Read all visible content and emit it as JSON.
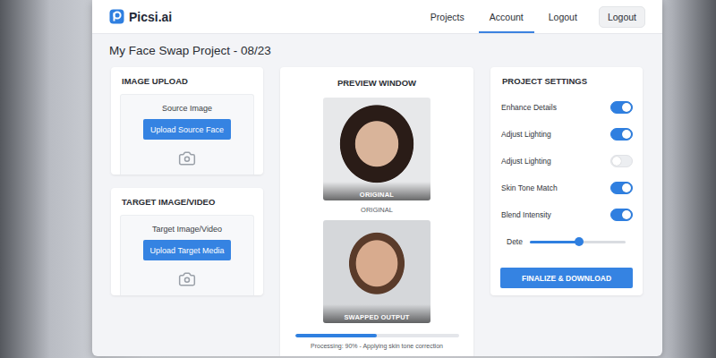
{
  "app": {
    "logo": "Picsi.ai"
  },
  "nav": [
    {
      "label": "Projects",
      "selected": false
    },
    {
      "label": "Account",
      "selected": true
    },
    {
      "label": "Logout",
      "selected": false
    }
  ],
  "nav_button": "Logout",
  "project_title": "My Face Swap Project - 08/23",
  "upload_cards": [
    {
      "title": "IMAGE UPLOAD",
      "label": "Source Image",
      "button": "Upload Source Face"
    },
    {
      "title": "TARGET IMAGE/VIDEO",
      "label": "Target Image/Video",
      "button": "Upload Target Media"
    }
  ],
  "preview": {
    "title": "PREVIEW WINDOW",
    "images": [
      {
        "overlay": "ORIGINAL",
        "caption": "ORIGINAL"
      },
      {
        "overlay": "SWAPPED OUTPUT",
        "caption": ""
      }
    ],
    "progress": {
      "level": 0.5,
      "text": "Processing: 90% - Applying skin tone correction"
    }
  },
  "settings": {
    "title": "PROJECT SETTINGS",
    "items": [
      {
        "kind": "toggle",
        "label": "Enhance Details",
        "on": true
      },
      {
        "kind": "toggle",
        "label": "Adjust Lighting",
        "on": true
      },
      {
        "kind": "toggle",
        "label": "Adjust Lighting",
        "on": false
      },
      {
        "kind": "toggle",
        "label": "Skin Tone Match",
        "on": true
      },
      {
        "kind": "toggle",
        "label": "Blend Intensity",
        "on": true
      },
      {
        "kind": "slider",
        "label": "Dete",
        "level": 0.51
      }
    ],
    "button": "FINALIZE & DOWNLOAD"
  }
}
